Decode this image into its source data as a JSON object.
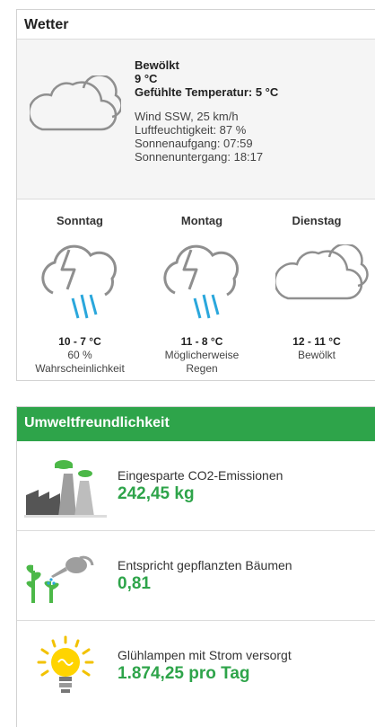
{
  "weather": {
    "title": "Wetter",
    "current": {
      "icon": "cloud-icon",
      "condition": "Bewölkt",
      "temperature": "9 °C",
      "feels_like": "Gefühlte Temperatur: 5 °C",
      "wind": "Wind SSW, 25 km/h",
      "humidity": "Luftfeuchtigkeit: 87 %",
      "sunrise": "Sonnenaufgang: 07:59",
      "sunset": "Sonnenuntergang: 18:17"
    },
    "forecast": [
      {
        "day": "Sonntag",
        "icon": "thunder-rain-icon",
        "temp": "10 - 7 °C",
        "desc1": "60 %",
        "desc2": "Wahrscheinlichkeit"
      },
      {
        "day": "Montag",
        "icon": "thunder-rain-icon",
        "temp": "11 - 8 °C",
        "desc1": "Möglicherweise",
        "desc2": "Regen"
      },
      {
        "day": "Dienstag",
        "icon": "cloud-icon",
        "temp": "12 - 11 °C",
        "desc1": "Bewölkt",
        "desc2": ""
      }
    ]
  },
  "eco": {
    "title": "Umweltfreundlichkeit",
    "accent": "#2ea44a",
    "rows": [
      {
        "icon": "factory-icon",
        "label": "Eingesparte CO2-Emissionen",
        "value": "242,45 kg"
      },
      {
        "icon": "plant-watering-icon",
        "label": "Entspricht gepflanzten Bäumen",
        "value": "0,81"
      },
      {
        "icon": "lightbulb-icon",
        "label": "Glühlampen mit Strom versorgt",
        "value": "1.874,25 pro Tag"
      }
    ]
  }
}
